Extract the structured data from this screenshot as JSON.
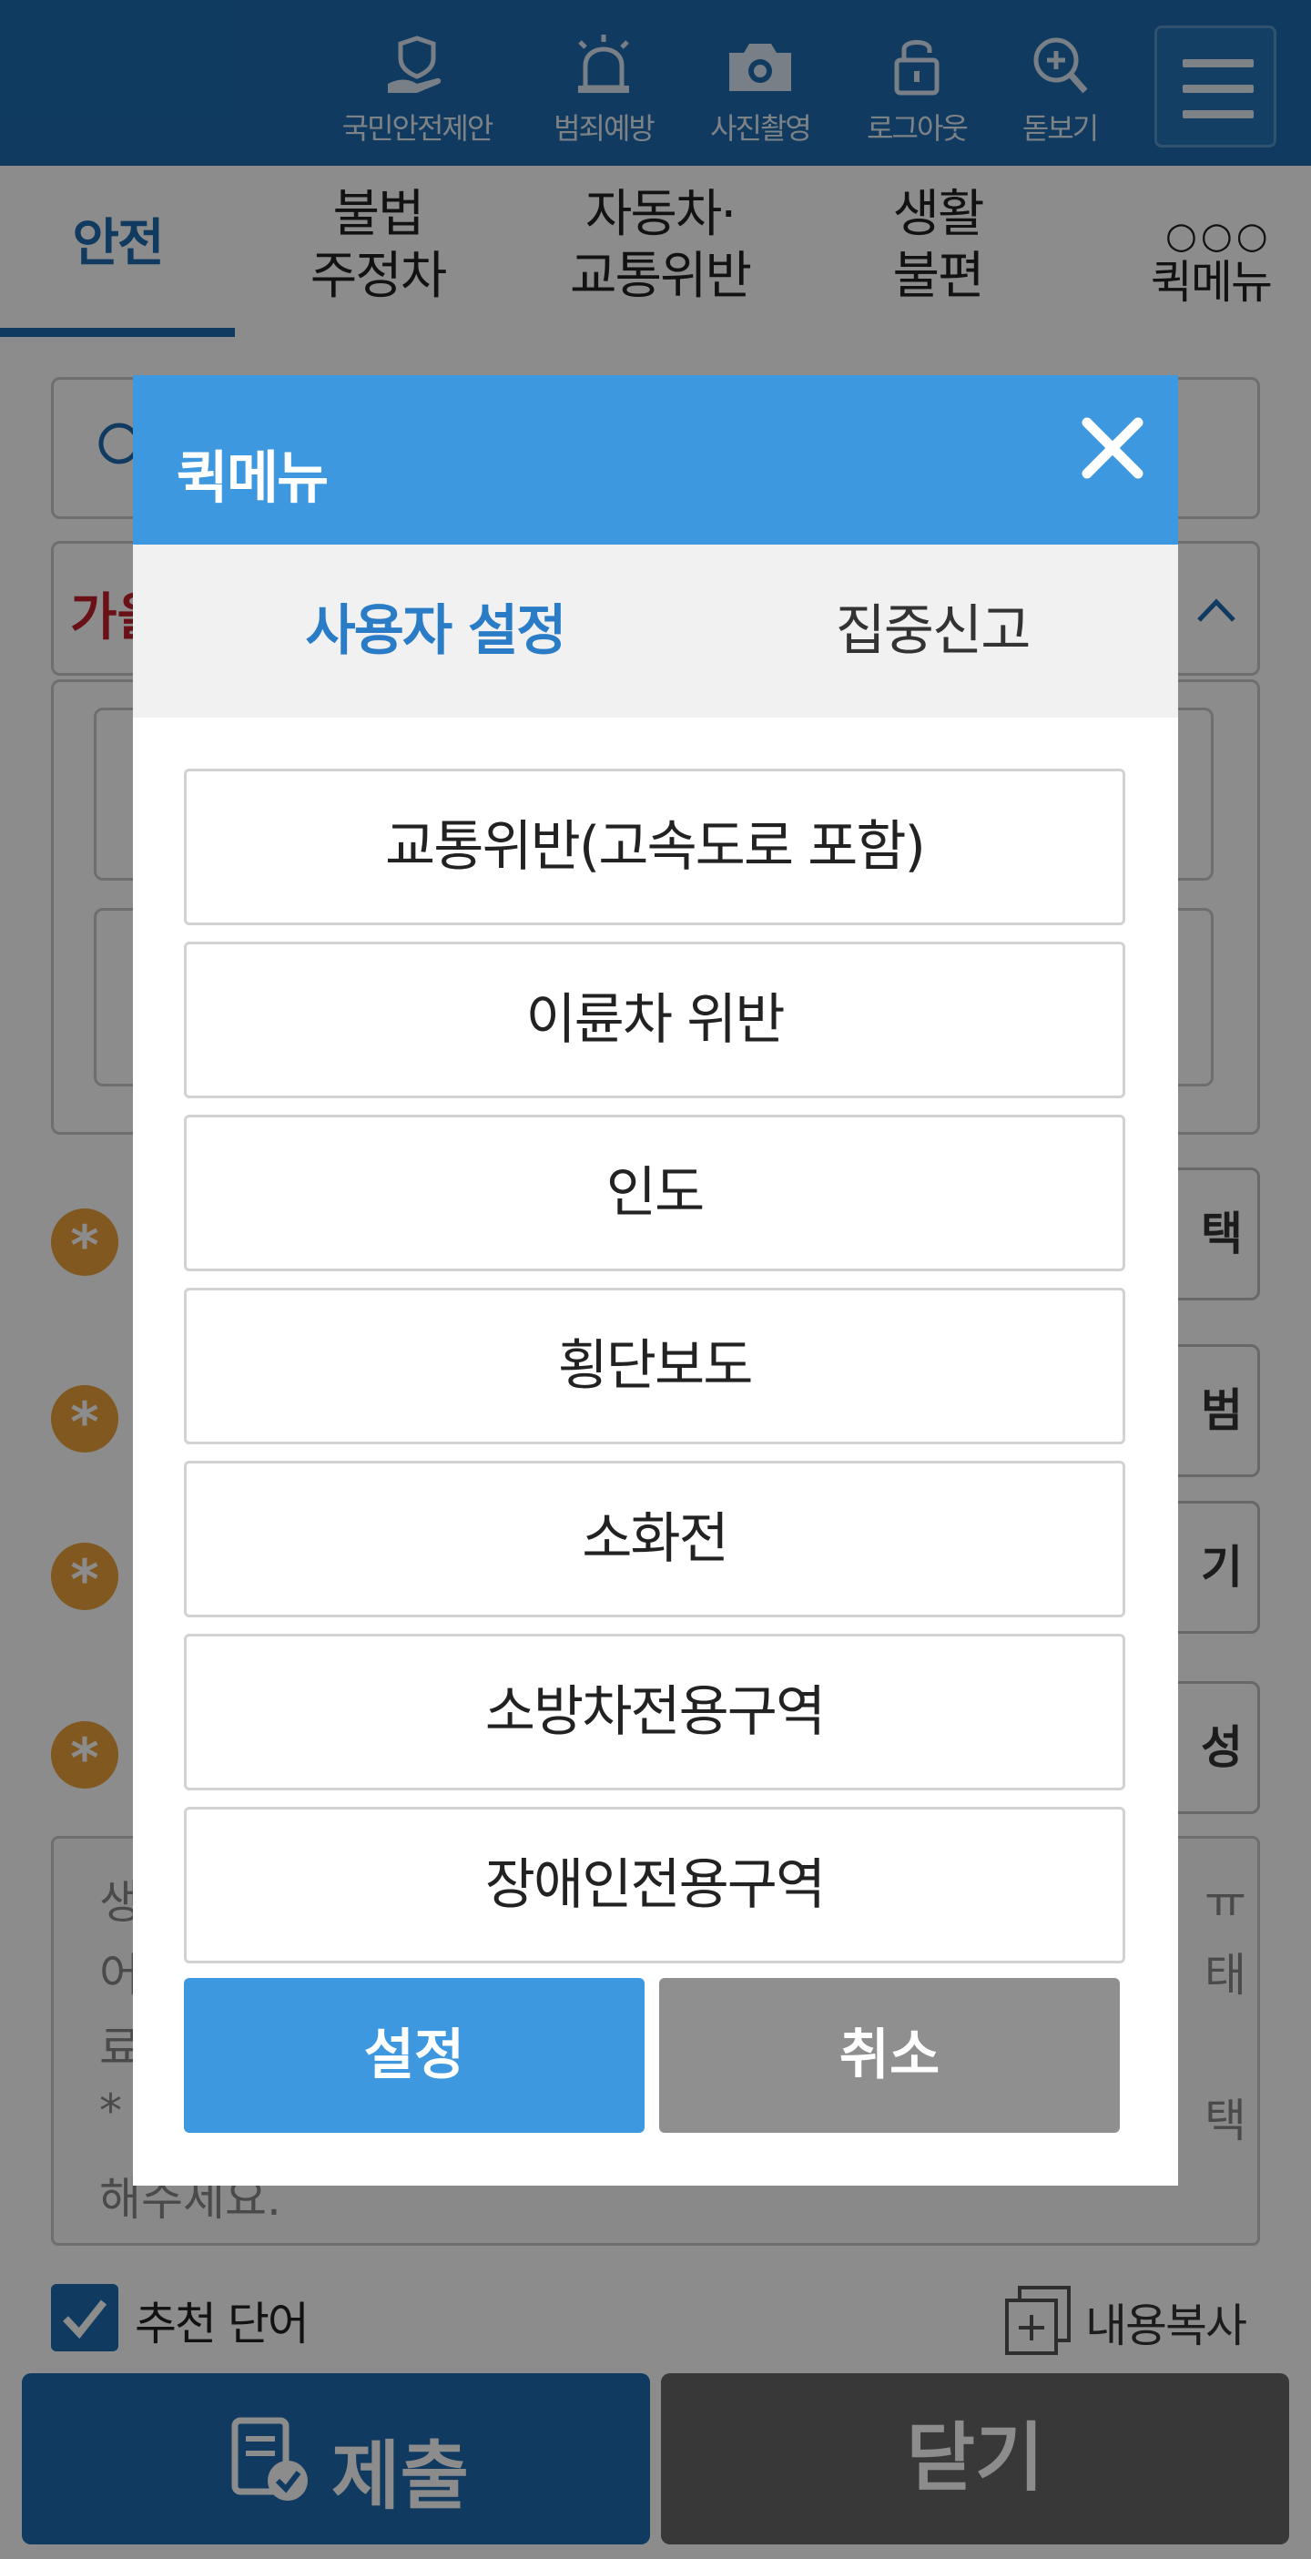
{
  "header": {
    "icons": [
      {
        "label": "국민안전제안",
        "icon": "hand-shield-icon"
      },
      {
        "label": "범죄예방",
        "icon": "siren-icon"
      },
      {
        "label": "사진촬영",
        "icon": "camera-icon"
      },
      {
        "label": "로그아웃",
        "icon": "lock-icon"
      },
      {
        "label": "돋보기",
        "icon": "magnifier-plus-icon"
      }
    ],
    "menu_icon": "hamburger-icon"
  },
  "tabs": [
    {
      "label_line1": "안전",
      "label_line2": "",
      "active": true
    },
    {
      "label_line1": "불법",
      "label_line2": "주정차",
      "active": false
    },
    {
      "label_line1": "자동차·",
      "label_line2": "교통위반",
      "active": false
    },
    {
      "label_line1": "생활",
      "label_line2": "불편",
      "active": false
    },
    {
      "label_line1": "퀵메뉴",
      "label_line2": "",
      "active": false
    }
  ],
  "background": {
    "red_text": "가을",
    "side_buttons": [
      "택",
      "범",
      "기",
      "성"
    ],
    "textarea_lines": [
      "생",
      "어",
      "료",
      "*",
      "해주세요."
    ],
    "textarea_right": [
      "ㅠ",
      "태",
      "택"
    ],
    "recommend_label": "추천 단어",
    "copy_label": "내용복사",
    "submit_label": "제출",
    "close_label": "닫기"
  },
  "modal": {
    "title": "퀵메뉴",
    "tabs": [
      "사용자 설정",
      "집중신고"
    ],
    "active_tab": "사용자 설정",
    "options": [
      "교통위반(고속도로 포함)",
      "이륜차 위반",
      "인도",
      "횡단보도",
      "소화전",
      "소방차전용구역",
      "장애인전용구역"
    ],
    "set_label": "설정",
    "cancel_label": "취소"
  },
  "colors": {
    "header": "#1e6bae",
    "modal_header": "#3d98e0",
    "accent": "#2a7cc7",
    "cancel": "#8f8f8f",
    "star": "#e9a13b"
  }
}
